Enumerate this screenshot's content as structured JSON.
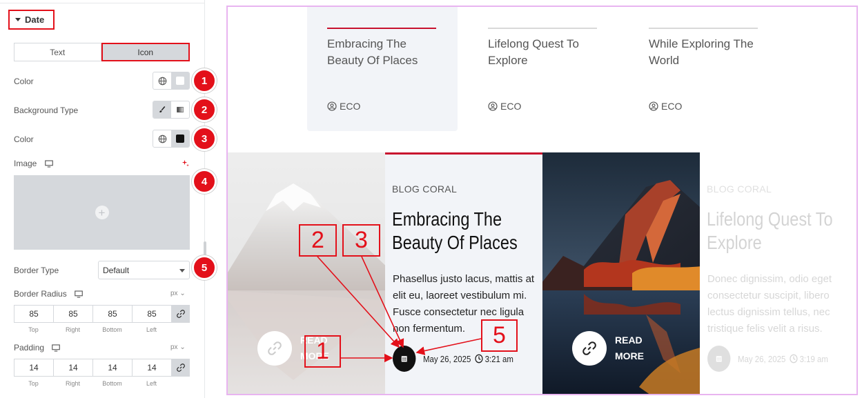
{
  "panel": {
    "section_title": "Date",
    "tabs": [
      "Text",
      "Icon"
    ],
    "color1_label": "Color",
    "bg_type_label": "Background Type",
    "color2_label": "Color",
    "image_label": "Image",
    "border_type_label": "Border Type",
    "border_type_value": "Default",
    "border_radius_label": "Border Radius",
    "border_radius_unit": "px",
    "border_radius_values": [
      "85",
      "85",
      "85",
      "85"
    ],
    "padding_label": "Padding",
    "padding_unit": "px",
    "padding_values": [
      "14",
      "14",
      "14",
      "14"
    ],
    "side_labels": [
      "Top",
      "Right",
      "Bottom",
      "Left"
    ],
    "badges": [
      "1",
      "2",
      "3",
      "4",
      "5"
    ],
    "color1_swatch": "#ffffff",
    "color2_swatch": "#111111"
  },
  "preview": {
    "top_cards": [
      {
        "title": "Embracing The Beauty Of Places",
        "tag": "ECO"
      },
      {
        "title": "Lifelong Quest To Explore",
        "tag": "ECO"
      },
      {
        "title": "While Exploring The World",
        "tag": "ECO"
      }
    ],
    "posts": [
      {
        "category": "BLOG CORAL",
        "title": "Embracing The Beauty Of Places",
        "excerpt": "Phasellus justo lacus, mattis at elit eu, laoreet vestibulum mi. Fusce consectetur nec ligula non fermentum.",
        "date": "May 26, 2025",
        "time": "3:21 am"
      },
      {
        "category": "BLOG CORAL",
        "title": "Lifelong Quest To Explore",
        "excerpt": "Donec dignissim, odio eget consectetur suscipit, libero lectus dignissim tellus, nec tristique felis velit a risus.",
        "date": "May 26, 2025",
        "time": "3:19 am"
      }
    ],
    "read_more": "READ MORE"
  },
  "annotations": [
    "1",
    "2",
    "3",
    "5"
  ],
  "colors": {
    "accent_red": "#e3101a",
    "title_red_line": "#c8102e",
    "preview_border": "#e8b4f0"
  }
}
